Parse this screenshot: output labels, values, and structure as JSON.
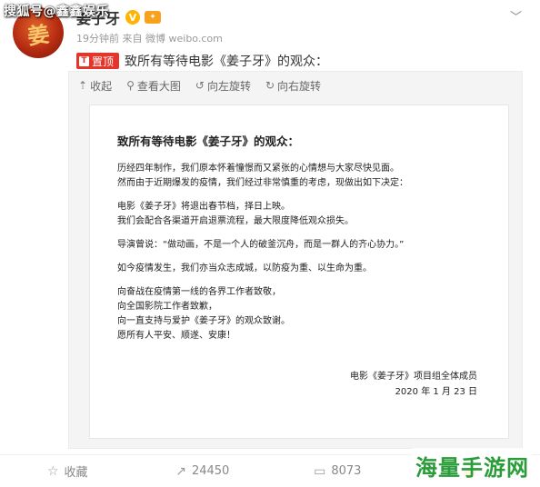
{
  "watermark_top": "搜狐号@鑫鑫娱乐",
  "watermark_bottom": "海量手游网",
  "avatar": {
    "glyph": "姜"
  },
  "author": {
    "name": "姜子牙",
    "verified_glyph": "V",
    "level_glyph": "✦"
  },
  "more_glyph": "﹀",
  "meta": {
    "time": "19分钟前",
    "source_prefix": "来自",
    "source": "微博 weibo.com"
  },
  "post": {
    "pin_icon": "T",
    "pin_label": "置顶",
    "text": "致所有等待电影《姜子牙》的观众："
  },
  "toolbar": [
    {
      "icon": "⇡",
      "label": "收起"
    },
    {
      "icon": "⚲",
      "label": "查看大图"
    },
    {
      "icon": "↺",
      "label": "向左旋转"
    },
    {
      "icon": "↻",
      "label": "向右旋转"
    }
  ],
  "notice": {
    "title": "致所有等待电影《姜子牙》的观众：",
    "paragraphs": [
      [
        "历经四年制作，我们原本怀着憧憬而又紧张的心情想与大家尽快见面。",
        "然而由于近期爆发的疫情，我们经过非常慎重的考虑，现做出如下决定："
      ],
      [
        "电影《姜子牙》将退出春节档，择日上映。",
        "我们会配合各渠道开启退票流程，最大限度降低观众损失。"
      ],
      [
        "导演曾说：“做动画，不是一个人的破釜沉舟，而是一群人的齐心协力。”"
      ],
      [
        "如今疫情发生，我们亦当众志成城，以防疫为重、以生命为重。"
      ],
      [
        "向奋战在疫情第一线的各界工作者致敬，",
        "向全国影院工作者致歉，",
        "向一直支持与爱护《姜子牙》的观众致谢。",
        "愿所有人平安、顺遂、安康！"
      ]
    ],
    "signature": "电影《姜子牙》项目组全体成员",
    "date": "2020 年 1 月 23 日"
  },
  "actions": [
    {
      "icon": "☆",
      "label": "收藏"
    },
    {
      "icon": "↗",
      "label": "24450"
    },
    {
      "icon": "▭",
      "label": "8073"
    },
    {
      "icon": "👍",
      "label": ""
    }
  ]
}
